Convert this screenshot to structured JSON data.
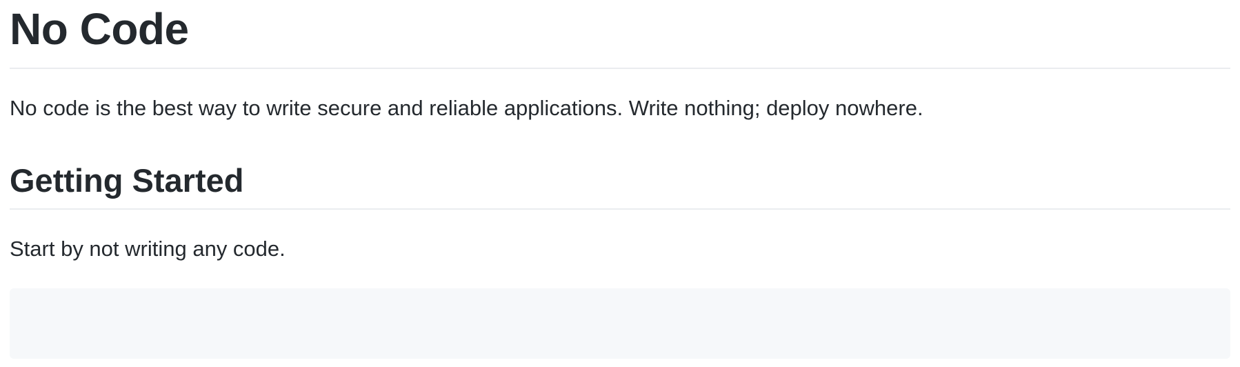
{
  "document": {
    "title": "No Code",
    "intro": "No code is the best way to write secure and reliable applications. Write nothing; deploy nowhere.",
    "section": {
      "heading": "Getting Started",
      "body": "Start by not writing any code.",
      "code_block_content": ""
    }
  },
  "colors": {
    "text": "#24292e",
    "rule": "#eaecef",
    "code_background": "#f6f8fa"
  }
}
